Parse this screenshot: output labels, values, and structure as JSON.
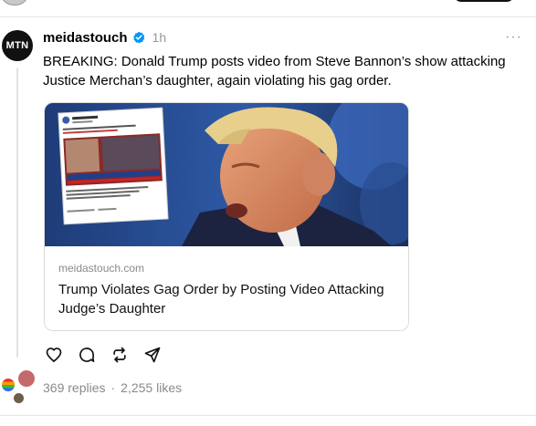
{
  "post": {
    "logo_text": "MTN",
    "username": "meidastouch",
    "time": "1h",
    "text": "BREAKING: Donald Trump posts video from Steve Bannon’s show attacking Justice Merchan’s daughter, again violating his gag order."
  },
  "link_card": {
    "domain": "meidastouch.com",
    "headline": "Trump Violates Gag Order by Posting Video Attacking Judge’s Daughter"
  },
  "stats": {
    "replies": "369 replies",
    "separator": "·",
    "likes": "2,255 likes"
  },
  "icons": {
    "verified": "verified-badge-icon",
    "more": "more-options-icon",
    "like": "heart-icon",
    "reply": "comment-icon",
    "repost": "repost-icon",
    "share": "send-icon"
  },
  "colors": {
    "verified_blue": "#0095f6",
    "muted_text": "#8a8a8a"
  }
}
